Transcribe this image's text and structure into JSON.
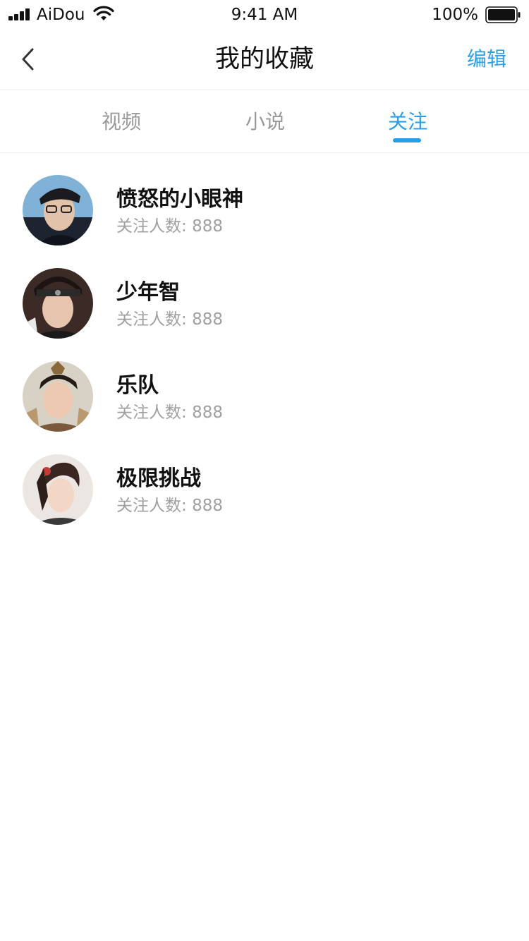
{
  "status_bar": {
    "carrier": "AiDou",
    "time": "9:41 AM",
    "battery": "100%"
  },
  "nav": {
    "title": "我的收藏",
    "edit_label": "编辑",
    "back_icon": "chevron-left-icon"
  },
  "tabs": [
    {
      "label": "视频",
      "active": false
    },
    {
      "label": "小说",
      "active": false
    },
    {
      "label": "关注",
      "active": true
    }
  ],
  "follow_list": [
    {
      "name": "愤怒的小眼神",
      "followers_label": "关注人数:",
      "followers_count": "888"
    },
    {
      "name": "少年智",
      "followers_label": "关注人数:",
      "followers_count": "888"
    },
    {
      "name": "乐队",
      "followers_label": "关注人数:",
      "followers_count": "888"
    },
    {
      "name": "极限挑战",
      "followers_label": "关注人数:",
      "followers_count": "888"
    }
  ],
  "colors": {
    "accent": "#2a9fe8",
    "text_primary": "#111111",
    "text_secondary": "#a0a0a0",
    "tab_inactive": "#999999"
  }
}
